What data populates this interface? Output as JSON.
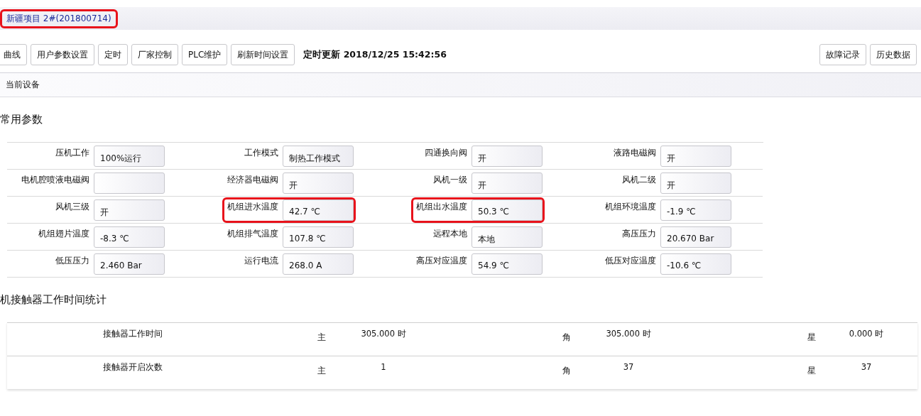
{
  "title": {
    "text": "新疆项目 2#(201800714)",
    "highlighted": true
  },
  "toolbar": {
    "buttons": [
      "曲线",
      "用户参数设置",
      "定时",
      "厂家控制",
      "PLC维护",
      "刷新时间设置"
    ],
    "update_time": "定时更新 2018/12/25 15:42:56",
    "right_buttons": [
      "故障记录",
      "历史数据"
    ]
  },
  "device_bar": {
    "label": "当前设备"
  },
  "common_params": {
    "heading": "常用参数",
    "items": [
      {
        "label": "压机工作",
        "value": "100%运行",
        "highlighted": false
      },
      {
        "label": "工作模式",
        "value": "制热工作模式",
        "highlighted": false
      },
      {
        "label": "四通换向阀",
        "value": "开",
        "highlighted": false
      },
      {
        "label": "液路电磁阀",
        "value": "开",
        "highlighted": false
      },
      {
        "label": "电机腔喷液电磁阀",
        "value": "",
        "highlighted": false
      },
      {
        "label": "经济器电磁阀",
        "value": "开",
        "highlighted": false
      },
      {
        "label": "风机一级",
        "value": "开",
        "highlighted": false
      },
      {
        "label": "风机二级",
        "value": "开",
        "highlighted": false
      },
      {
        "label": "风机三级",
        "value": "开",
        "highlighted": false
      },
      {
        "label": "机组进水温度",
        "value": "42.7 ℃",
        "highlighted": true
      },
      {
        "label": "机组出水温度",
        "value": "50.3 ℃",
        "highlighted": true
      },
      {
        "label": "机组环境温度",
        "value": "-1.9 ℃",
        "highlighted": false
      },
      {
        "label": "机组翅片温度",
        "value": "-8.3 ℃",
        "highlighted": false
      },
      {
        "label": "机组排气温度",
        "value": "107.8 ℃",
        "highlighted": false
      },
      {
        "label": "远程本地",
        "value": "本地",
        "highlighted": false
      },
      {
        "label": "高压压力",
        "value": "20.670 Bar",
        "highlighted": false
      },
      {
        "label": "低压压力",
        "value": "2.460 Bar",
        "highlighted": false
      },
      {
        "label": "运行电流",
        "value": "268.0 A",
        "highlighted": false
      },
      {
        "label": "高压对应温度",
        "value": "54.9 ℃",
        "highlighted": false
      },
      {
        "label": "低压对应温度",
        "value": "-10.6 ℃",
        "highlighted": false
      }
    ]
  },
  "contactor_stats": {
    "heading": "机接触器工作时间统计",
    "rows": [
      {
        "label": "接触器工作时间",
        "groups": [
          {
            "tag": "主",
            "value": "305.000 时"
          },
          {
            "tag": "角",
            "value": "305.000 时"
          },
          {
            "tag": "星",
            "value": "0.000 时"
          }
        ]
      },
      {
        "label": "接触器开启次数",
        "groups": [
          {
            "tag": "主",
            "value": "1"
          },
          {
            "tag": "角",
            "value": "37"
          },
          {
            "tag": "星",
            "value": "37"
          }
        ]
      }
    ]
  }
}
